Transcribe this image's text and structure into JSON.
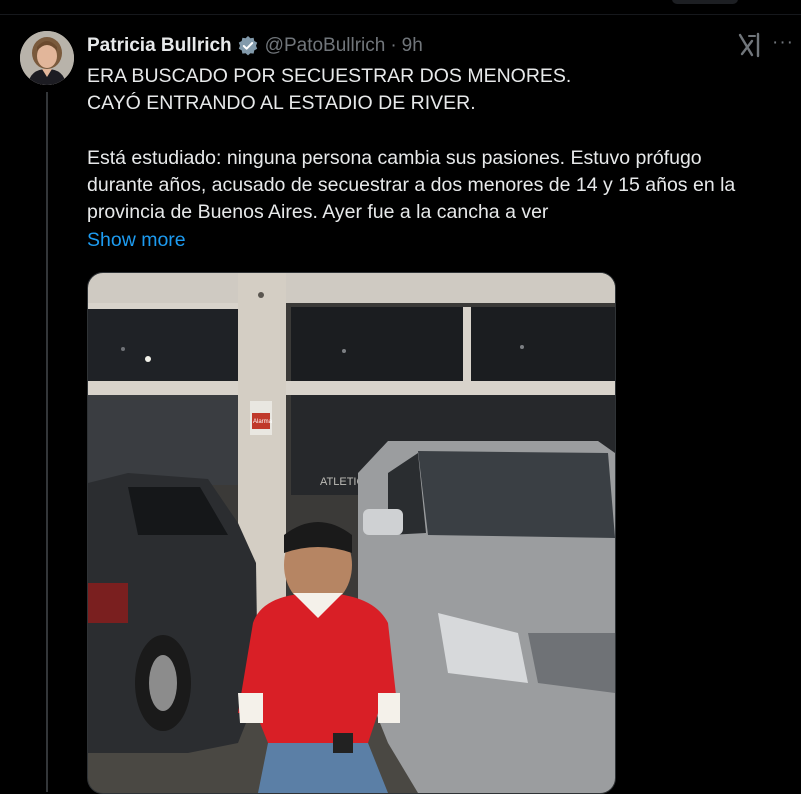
{
  "tweet": {
    "author_name": "Patricia Bullrich",
    "handle": "@PatoBullrich",
    "separator": "·",
    "time": "9h",
    "lines": [
      "ERA BUSCADO POR SECUESTRAR DOS MENORES.",
      "CAYÓ ENTRANDO AL ESTADIO DE RIVER.",
      "",
      "Está estudiado: ninguna persona cambia sus pasiones. Estuvo prófugo",
      "durante años, acusado de secuestrar a dos menores de 14 y 15 años en la",
      "provincia de Buenos Aires. Ayer fue a la cancha a ver"
    ],
    "show_more_label": "Show more",
    "more_label": "···"
  },
  "media": {
    "storefront_sign": "ATLETICO | SER...",
    "alarm_sign": "Alarma"
  },
  "colors": {
    "background": "#000000",
    "text": "#e7e9ea",
    "muted": "#71767b",
    "link": "#1d9bf0",
    "verified": "#829aab"
  },
  "icons": {
    "verified": "verified-badge-icon",
    "grok": "grok-icon",
    "more": "more-options-icon"
  }
}
